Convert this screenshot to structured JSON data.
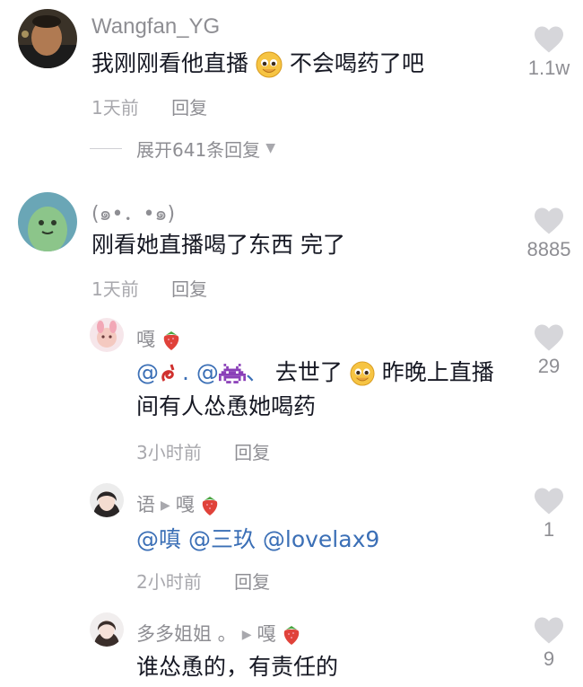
{
  "comments": [
    {
      "username": "Wangfan_YG",
      "text_before": "我刚刚看他直播",
      "emoji": "pleading-face-emoji",
      "text_after": " 不会喝药了吧",
      "time": "1天前",
      "reply_label": "回复",
      "likes": "1.1w",
      "expand_label": "展开641条回复",
      "replies": [
        {
          "username": "嘎",
          "username_emoji": "strawberry-emoji",
          "text_mentions": [
            "@",
            ". @",
            "、"
          ],
          "text_mid": " 去世了",
          "text_end": " 昨晚上直播间有人怂恿她喝药",
          "time": "3小时前",
          "reply_label": "回复",
          "likes": "29"
        },
        {
          "username": "语",
          "reply_to": "嘎",
          "username_emoji": "strawberry-emoji",
          "text": "@嗔 @三玖 @lovelax9",
          "time": "2小时前",
          "reply_label": "回复",
          "likes": "1"
        },
        {
          "username": "多多姐姐 。",
          "reply_to": "嘎",
          "username_emoji": "strawberry-emoji",
          "text": "谁怂恿的，有责任的",
          "likes": "9"
        }
      ]
    },
    {
      "username": "(๑•．•๑)",
      "text": "刚看她直播喝了东西 完了",
      "time": "1天前",
      "reply_label": "回复",
      "likes": "8885"
    }
  ],
  "colors": {
    "username": "#8e8e93",
    "text": "#161823",
    "mention": "#3b6fb6",
    "meta": "#a8a8ad",
    "heart": "#d6d6da"
  },
  "icons": [
    "heart-icon",
    "caret-down-icon",
    "triangle-right-icon"
  ]
}
